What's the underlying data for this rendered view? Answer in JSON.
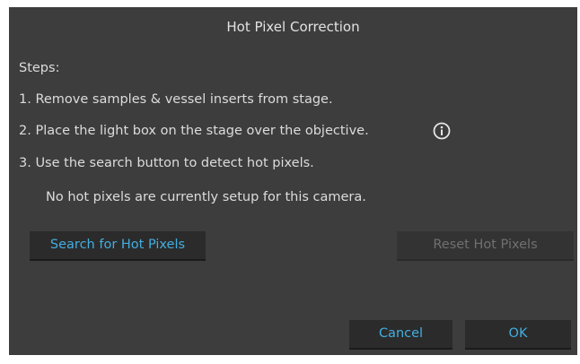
{
  "dialog": {
    "title": "Hot Pixel Correction",
    "steps_heading": "Steps:",
    "steps": [
      "1. Remove samples & vessel inserts from stage.",
      "2. Place the light box on the stage over the objective.",
      "3. Use the search button to detect hot pixels."
    ],
    "info_icon": "info-circle-icon",
    "status_message": "No hot pixels are currently setup for this camera.",
    "buttons": {
      "search_label": "Search for Hot Pixels",
      "reset_label": "Reset Hot Pixels",
      "reset_enabled": false,
      "cancel_label": "Cancel",
      "ok_label": "OK"
    }
  },
  "colors": {
    "background": "#3d3d3d",
    "button_bg": "#2b2b2b",
    "accent": "#43aee0",
    "text": "#dcdcdc",
    "disabled_text": "#707070"
  }
}
